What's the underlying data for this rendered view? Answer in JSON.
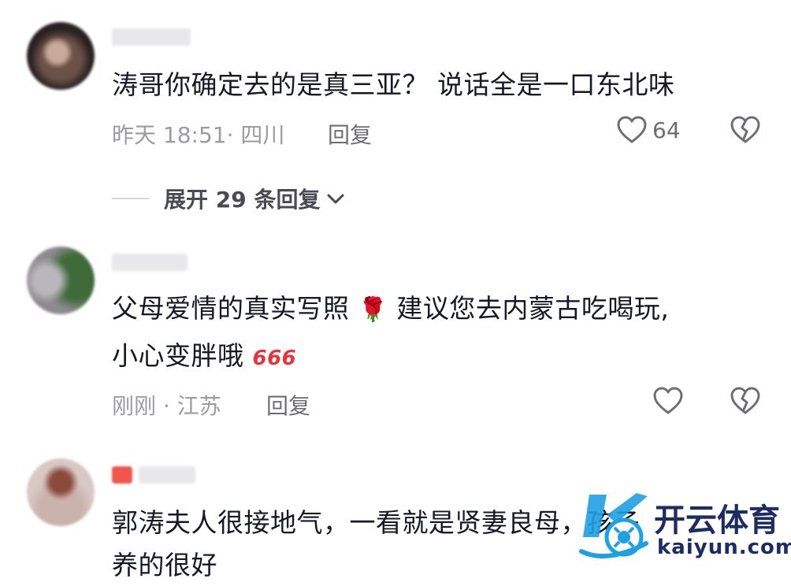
{
  "comments": [
    {
      "text": "涛哥你确定去的是真三亚？  说话全是一口东北味",
      "meta": "昨天 18:51· 四川",
      "reply_label": "回复",
      "like_count": "64",
      "expand_label": "展开 29 条回复"
    },
    {
      "text_line1_a": "父母爱情的真实写照",
      "text_line1_emoji": "🌹",
      "text_line1_b": "建议您去内蒙古吃喝玩,",
      "text_line2": "小心变胖哦",
      "text_line2_emoji": "666",
      "meta": "刚刚 · 江苏",
      "reply_label": "回复"
    },
    {
      "text_line1": "郭涛夫人很接地气，一看就是贤妻良母，孩子",
      "text_line2": "养的很好"
    }
  ],
  "watermark": {
    "brand": "开云体育",
    "url": "kaiyun.com"
  },
  "colors": {
    "text": "#161823",
    "meta": "#9b9ba1",
    "icon": "#6d6d73",
    "watermark": "#1d2c63",
    "emoji_red": "#e8323c"
  }
}
